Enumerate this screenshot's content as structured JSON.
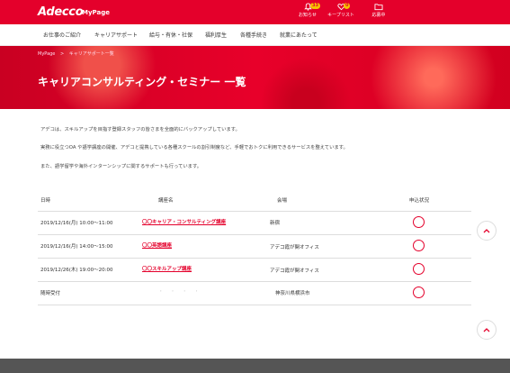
{
  "header": {
    "logo": "Adecco",
    "mypage": "MyPage",
    "icons": [
      {
        "name": "bell-icon",
        "label": "お知らせ",
        "badge": "33"
      },
      {
        "name": "heart-icon",
        "label": "キープリスト",
        "badge": "0"
      },
      {
        "name": "folder-icon",
        "label": "応募中",
        "badge": ""
      }
    ]
  },
  "nav": {
    "items": [
      "お仕事のご紹介",
      "キャリアサポート",
      "給与・有休・社保",
      "福利厚生",
      "各種手続き",
      "就業にあたって"
    ]
  },
  "hero": {
    "breadcrumb": [
      "MyPage",
      ">",
      "キャリアサポート一覧"
    ],
    "title": "キャリアコンサルティング・セミナー 一覧"
  },
  "intro": {
    "line1": "アデコは、スキルアップを目指す登録スタッフの皆さまを全面的にバックアップしています。",
    "line2": "実務に役立つOA や語学講座の開催、アデコと提携している各種スクールの割引制度など、手軽でおトクに利用できるサービスを整えています。",
    "line3": "また、語学留学や海外インターンシップに関するサポートも行っています。"
  },
  "table": {
    "headers": {
      "date": "日時",
      "course": "講座名",
      "venue": "会場",
      "status": "申込状況"
    },
    "rows": [
      {
        "date": "2019/12/16(月) 10:00〜11:00",
        "course": "〇〇キャリア・コンサルティング講座",
        "venue": "新宿"
      },
      {
        "date": "2019/12/16(月) 14:00〜15:00",
        "course": "〇〇英語講座",
        "venue": "アデコ霞が関オフィス"
      },
      {
        "date": "2019/12/26(木) 19:00〜20:00",
        "course": "〇〇スキルアップ講座",
        "venue": "アデコ霞が関オフィス"
      },
      {
        "date": "随時受付",
        "course": "・ ・ ・ ・",
        "venue": "神奈川県横浜市"
      }
    ]
  },
  "colors": {
    "brand": "#e4002b"
  }
}
